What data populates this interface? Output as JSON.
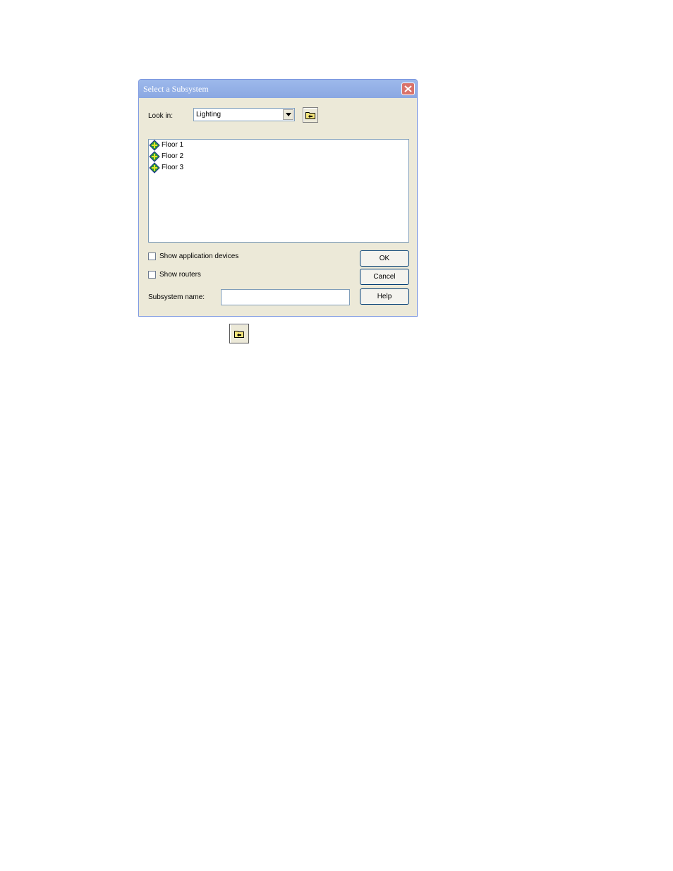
{
  "dialog": {
    "title": "Select a Subsystem",
    "look_in_label": "Look in:",
    "look_in_value": "Lighting",
    "items": [
      {
        "label": "Floor 1",
        "icon": "subsystem-icon"
      },
      {
        "label": "Floor 2",
        "icon": "subsystem-icon"
      },
      {
        "label": "Floor 3",
        "icon": "subsystem-icon"
      }
    ],
    "show_app_devices_label": "Show application devices",
    "show_routers_label": "Show routers",
    "subsystem_name_label": "Subsystem name:",
    "subsystem_name_value": "",
    "ok_label": "OK",
    "cancel_label": "Cancel",
    "help_label": "Help"
  },
  "colors": {
    "titlebar": "#8aa7e2",
    "dialog_bg": "#ece9d8",
    "close_button": "#d9726a"
  }
}
